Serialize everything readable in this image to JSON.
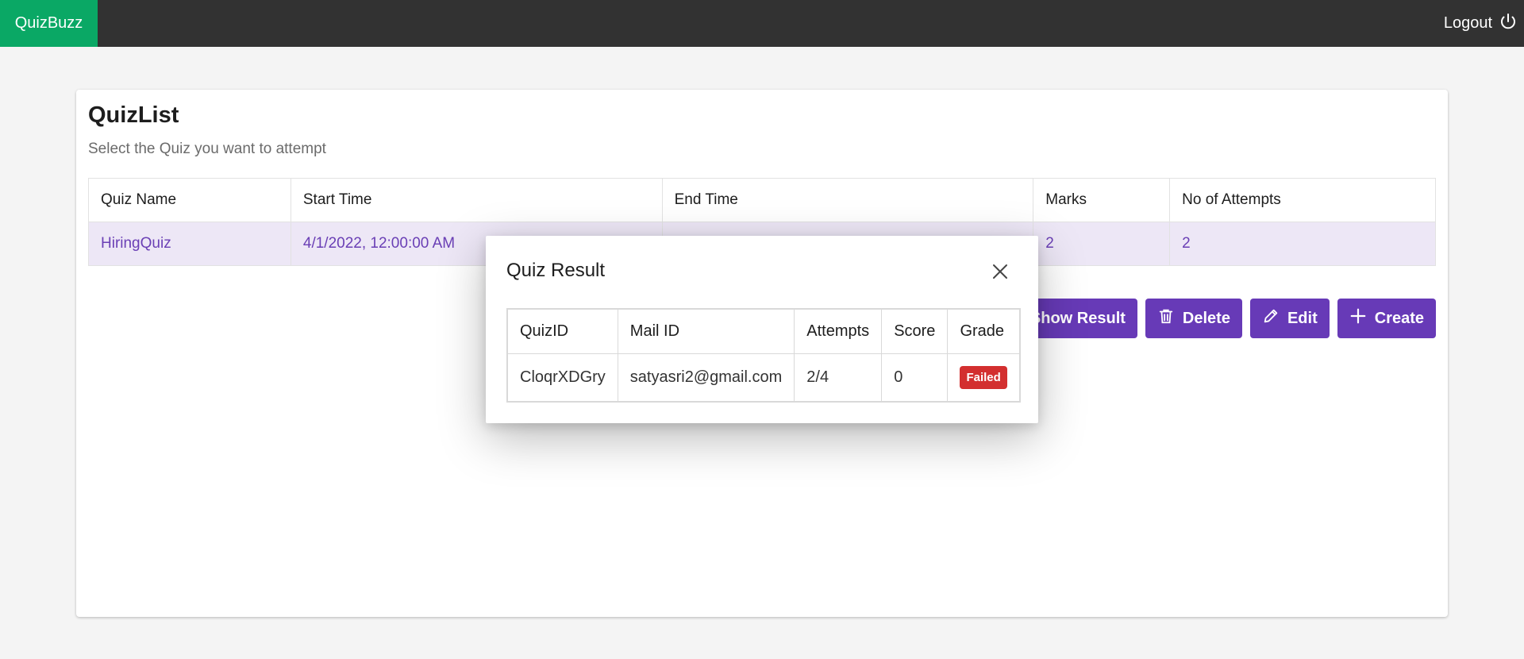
{
  "app": {
    "brand": "QuizBuzz",
    "logout_label": "Logout"
  },
  "page": {
    "title": "QuizList",
    "subtitle": "Select the Quiz you want to attempt"
  },
  "quiz_table": {
    "headers": [
      "Quiz Name",
      "Start Time",
      "End Time",
      "Marks",
      "No of Attempts"
    ],
    "rows": [
      {
        "name": "HiringQuiz",
        "start": "4/1/2022, 12:00:00 AM",
        "end": "",
        "marks": "2",
        "attempts": "2"
      }
    ]
  },
  "actions": {
    "show_result": "Show Result",
    "delete": "Delete",
    "edit": "Edit",
    "create": "Create"
  },
  "modal": {
    "title": "Quiz Result",
    "headers": [
      "QuizID",
      "Mail ID",
      "Attempts",
      "Score",
      "Grade"
    ],
    "rows": [
      {
        "quiz_id": "CloqrXDGry",
        "mail": "satyasri2@gmail.com",
        "attempts": "2/4",
        "score": "0",
        "grade": "Failed"
      }
    ]
  },
  "colors": {
    "brand": "#0aa865",
    "topbar": "#323232",
    "accent": "#673ab7",
    "row_highlight": "#ede7f6",
    "failed": "#d32f2f"
  }
}
